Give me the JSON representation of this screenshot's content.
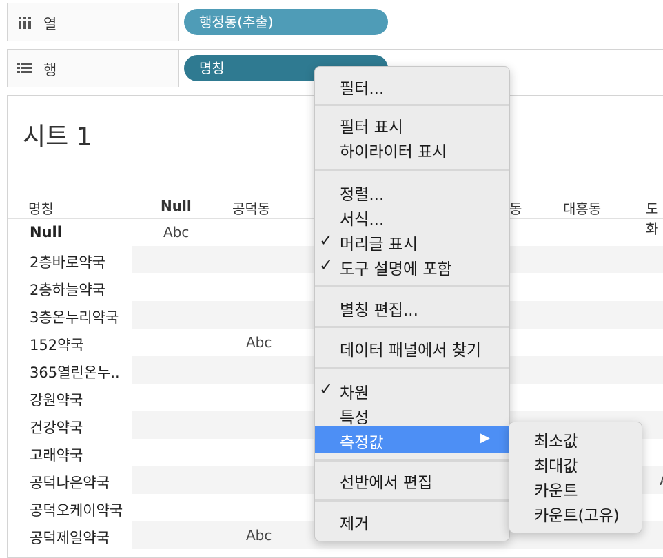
{
  "shelves": {
    "columns": {
      "label": "열",
      "pill": "행정동(추출)",
      "pill_color": "#4f9cb7"
    },
    "rows": {
      "label": "행",
      "pill": "명칭",
      "pill_color": "#2f7a91"
    }
  },
  "sheet": {
    "title": "시트 1",
    "headers": [
      "명칭",
      "Null",
      "공덕동",
      "동",
      "대흥동",
      "도화"
    ],
    "rows": [
      "Null",
      "2층바로약국",
      "2층하늘약국",
      "3층온누리약국",
      "152약국",
      "365열린온누..",
      "강원약국",
      "건강약국",
      "고래약국",
      "공덕나은약국",
      "공덕오케이약국",
      "공덕제일약국"
    ],
    "cells": [
      {
        "row": "Null",
        "column": "Null",
        "value": "Abc"
      },
      {
        "row": "152약국",
        "column": "공덕동",
        "value": "Abc"
      },
      {
        "row": "공덕나은약국",
        "column": "도화",
        "value": "A"
      },
      {
        "row": "공덕제일약국",
        "column": "공덕동",
        "value": "Abc"
      }
    ]
  },
  "context_menu": {
    "filter": "필터...",
    "show_filter": "필터 표시",
    "show_highlighter": "하이라이터 표시",
    "sort": "정렬...",
    "format": "서식...",
    "show_header": "머리글 표시",
    "include_in_tooltip": "도구 설명에 포함",
    "edit_alias": "별칭 편집...",
    "find_in_data_pane": "데이터 패널에서 찾기",
    "dimension": "차원",
    "attribute": "특성",
    "measure": "측정값",
    "edit_in_shelf": "선반에서 편집",
    "remove": "제거",
    "checkmark": "✓",
    "submenu_arrow": "▶",
    "highlight_color": "#4d8ff5"
  },
  "submenu": {
    "items": [
      "최소값",
      "최대값",
      "카운트",
      "카운트(고유)"
    ]
  }
}
